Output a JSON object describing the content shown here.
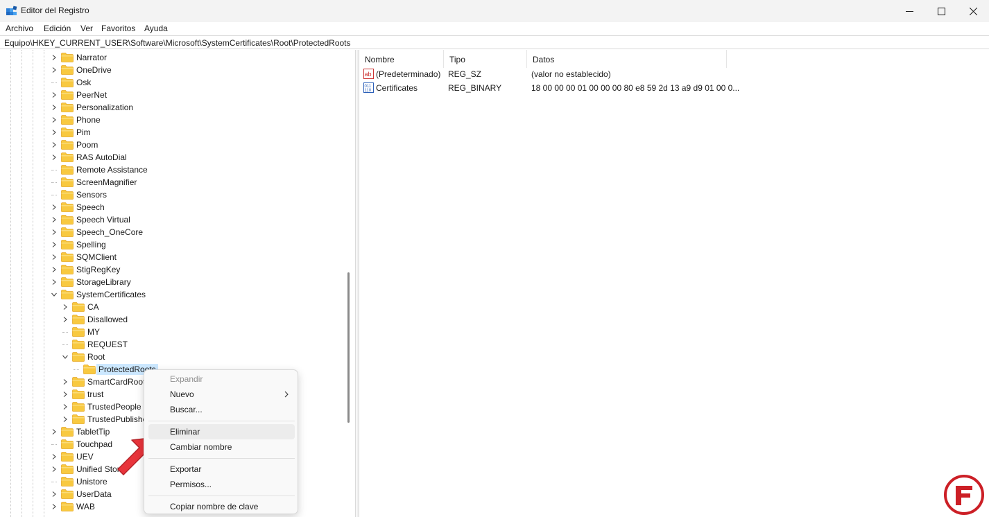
{
  "window": {
    "title": "Editor del Registro",
    "controls": {
      "minimize": "minimize",
      "maximize": "maximize",
      "close": "close"
    }
  },
  "menu": {
    "items": [
      "Archivo",
      "Edición",
      "Ver",
      "Favoritos",
      "Ayuda"
    ]
  },
  "address": {
    "path": "Equipo\\HKEY_CURRENT_USER\\Software\\Microsoft\\SystemCertificates\\Root\\ProtectedRoots"
  },
  "tree": {
    "items": [
      {
        "label": "Narrator",
        "level": 0,
        "expander": "collapsed"
      },
      {
        "label": "OneDrive",
        "level": 0,
        "expander": "collapsed"
      },
      {
        "label": "Osk",
        "level": 0,
        "expander": "none"
      },
      {
        "label": "PeerNet",
        "level": 0,
        "expander": "collapsed"
      },
      {
        "label": "Personalization",
        "level": 0,
        "expander": "collapsed"
      },
      {
        "label": "Phone",
        "level": 0,
        "expander": "collapsed"
      },
      {
        "label": "Pim",
        "level": 0,
        "expander": "collapsed"
      },
      {
        "label": "Poom",
        "level": 0,
        "expander": "collapsed"
      },
      {
        "label": "RAS AutoDial",
        "level": 0,
        "expander": "collapsed"
      },
      {
        "label": "Remote Assistance",
        "level": 0,
        "expander": "none"
      },
      {
        "label": "ScreenMagnifier",
        "level": 0,
        "expander": "none"
      },
      {
        "label": "Sensors",
        "level": 0,
        "expander": "none"
      },
      {
        "label": "Speech",
        "level": 0,
        "expander": "collapsed"
      },
      {
        "label": "Speech Virtual",
        "level": 0,
        "expander": "collapsed"
      },
      {
        "label": "Speech_OneCore",
        "level": 0,
        "expander": "collapsed"
      },
      {
        "label": "Spelling",
        "level": 0,
        "expander": "collapsed"
      },
      {
        "label": "SQMClient",
        "level": 0,
        "expander": "collapsed"
      },
      {
        "label": "StigRegKey",
        "level": 0,
        "expander": "collapsed"
      },
      {
        "label": "StorageLibrary",
        "level": 0,
        "expander": "collapsed"
      },
      {
        "label": "SystemCertificates",
        "level": 0,
        "expander": "expanded"
      },
      {
        "label": "CA",
        "level": 1,
        "expander": "collapsed"
      },
      {
        "label": "Disallowed",
        "level": 1,
        "expander": "collapsed"
      },
      {
        "label": "MY",
        "level": 1,
        "expander": "none"
      },
      {
        "label": "REQUEST",
        "level": 1,
        "expander": "none"
      },
      {
        "label": "Root",
        "level": 1,
        "expander": "expanded"
      },
      {
        "label": "ProtectedRoots",
        "level": 2,
        "expander": "none",
        "selected": true
      },
      {
        "label": "SmartCardRoot",
        "level": 1,
        "expander": "collapsed"
      },
      {
        "label": "trust",
        "level": 1,
        "expander": "collapsed"
      },
      {
        "label": "TrustedPeople",
        "level": 1,
        "expander": "collapsed"
      },
      {
        "label": "TrustedPublisher",
        "level": 1,
        "expander": "collapsed"
      },
      {
        "label": "TabletTip",
        "level": 0,
        "expander": "collapsed"
      },
      {
        "label": "Touchpad",
        "level": 0,
        "expander": "none"
      },
      {
        "label": "UEV",
        "level": 0,
        "expander": "collapsed"
      },
      {
        "label": "Unified Store",
        "level": 0,
        "expander": "collapsed"
      },
      {
        "label": "Unistore",
        "level": 0,
        "expander": "none"
      },
      {
        "label": "UserData",
        "level": 0,
        "expander": "collapsed"
      },
      {
        "label": "WAB",
        "level": 0,
        "expander": "collapsed"
      }
    ]
  },
  "list": {
    "columns": [
      "Nombre",
      "Tipo",
      "Datos"
    ],
    "rows": [
      {
        "icon": "string-value-icon",
        "name": "(Predeterminado)",
        "type": "REG_SZ",
        "data": "(valor no establecido)"
      },
      {
        "icon": "binary-value-icon",
        "name": "Certificates",
        "type": "REG_BINARY",
        "data": "18 00 00 00 01 00 00 00 80 e8 59 2d 13 a9 d9 01 00 0..."
      }
    ]
  },
  "context_menu": {
    "items": [
      {
        "label": "Expandir",
        "disabled": true
      },
      {
        "label": "Nuevo",
        "submenu": true
      },
      {
        "label": "Buscar..."
      },
      {
        "separator": true
      },
      {
        "label": "Eliminar",
        "hover": true
      },
      {
        "label": "Cambiar nombre"
      },
      {
        "separator": true
      },
      {
        "label": "Exportar"
      },
      {
        "label": "Permisos..."
      },
      {
        "separator": true
      },
      {
        "label": "Copiar nombre de clave"
      }
    ]
  },
  "colors": {
    "folder": "#f8c940",
    "folder_dark": "#e7a92a",
    "selection": "#cce8ff",
    "arrow_red": "#e8343b",
    "watermark": "#cc1f26"
  }
}
